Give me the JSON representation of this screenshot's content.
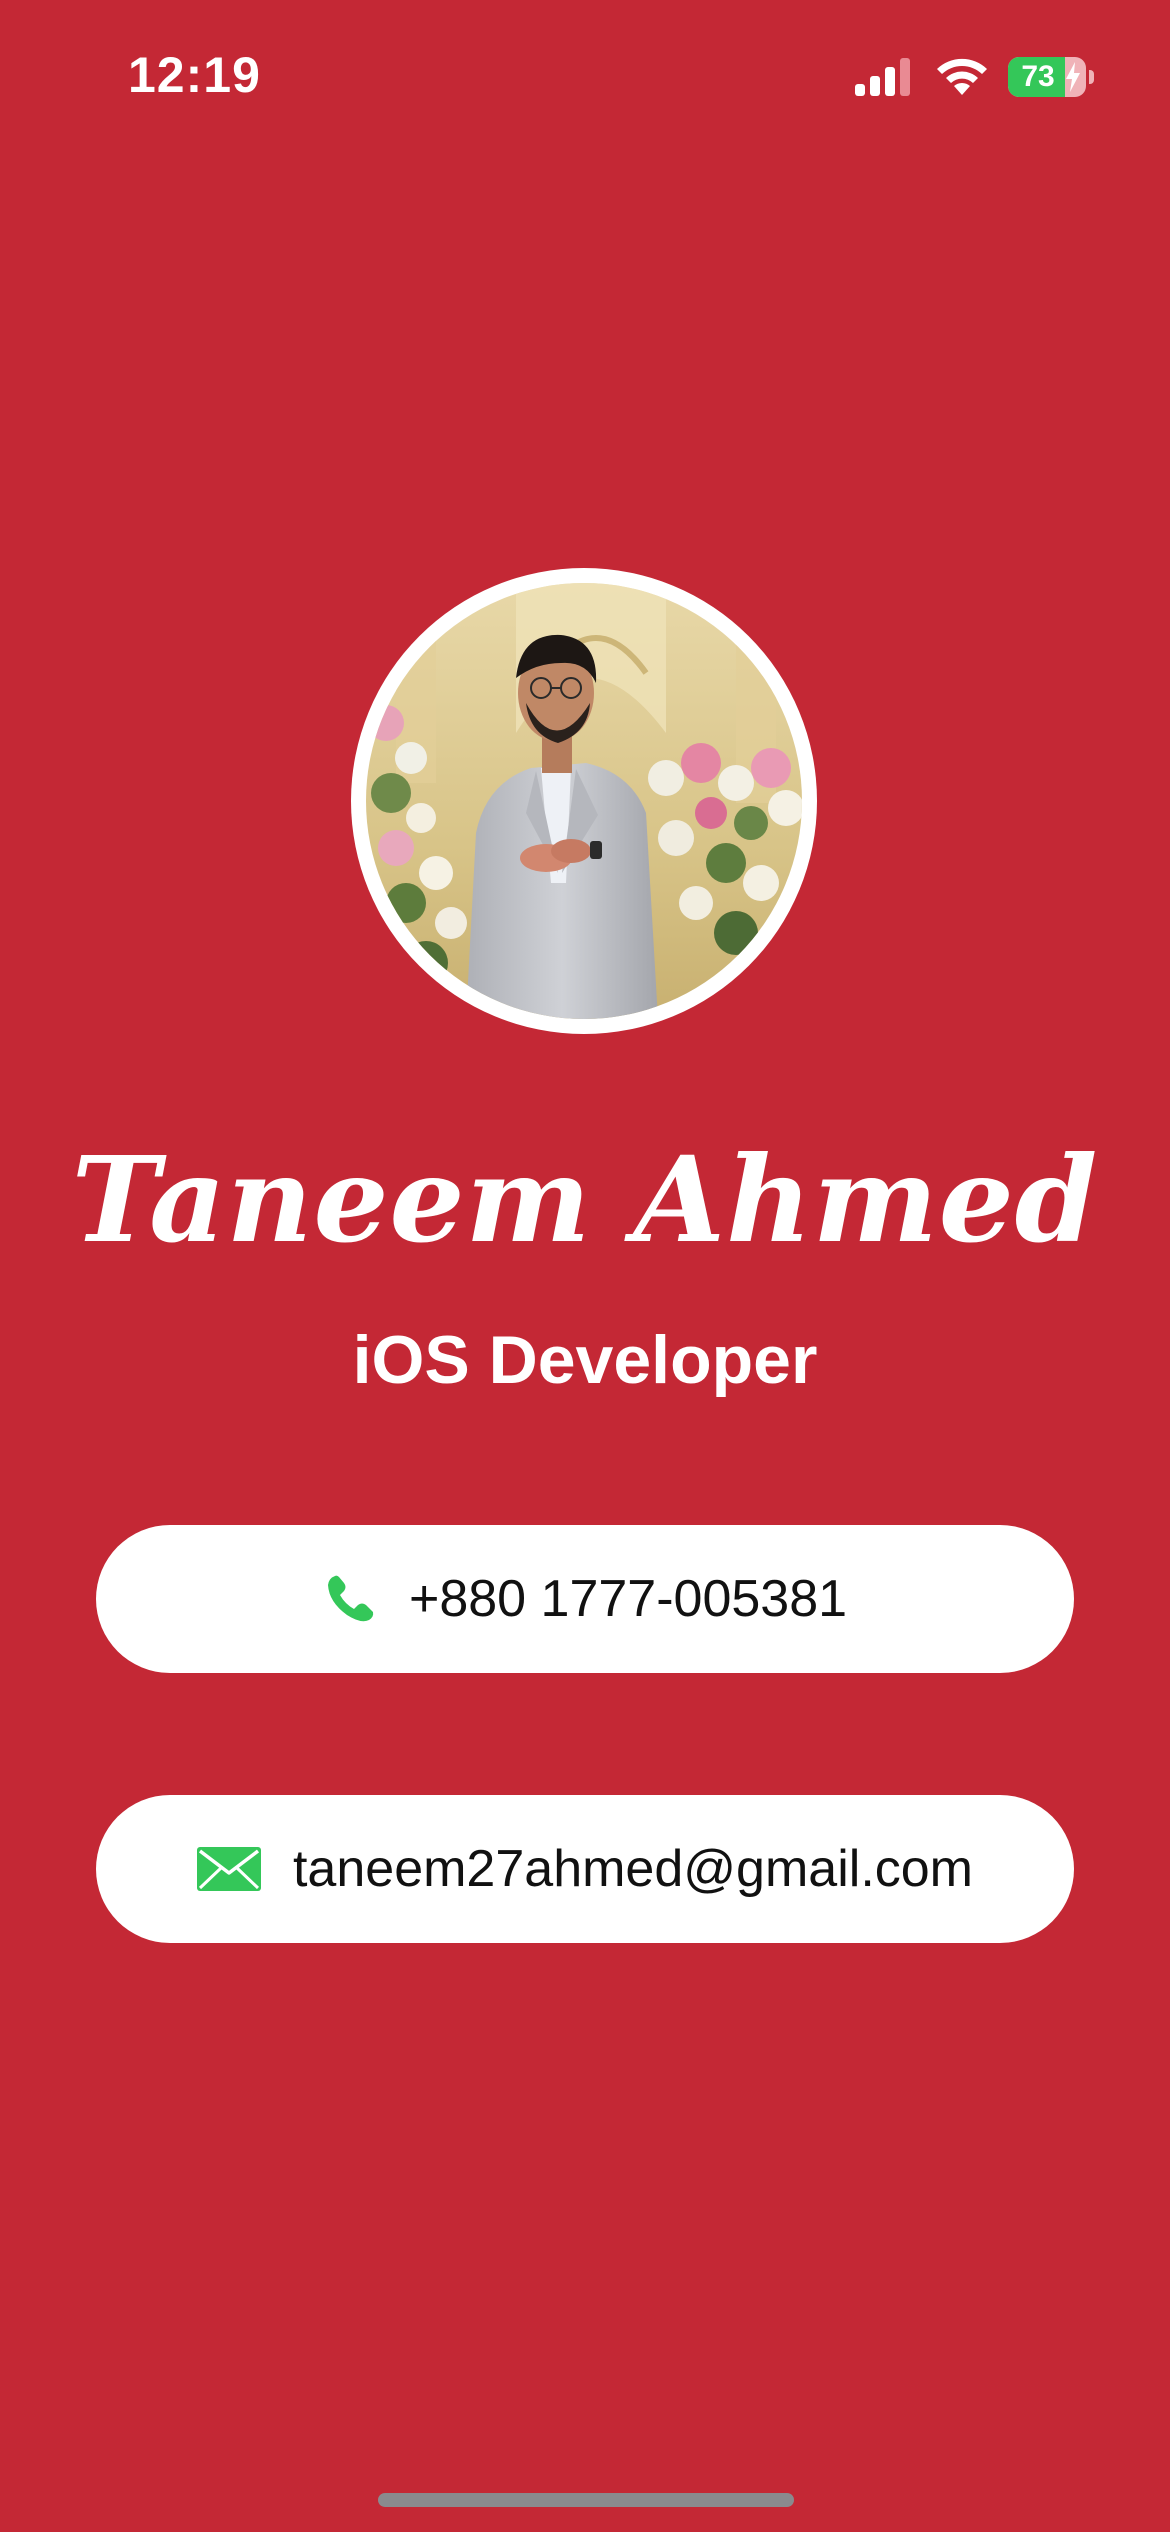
{
  "status_bar": {
    "time": "12:19",
    "battery_percent": "73",
    "battery_level": 0.73,
    "charging": true,
    "icons": [
      "cellular-signal-icon",
      "wifi-icon",
      "battery-charging-icon"
    ]
  },
  "profile": {
    "name": "Taneem Ahmed",
    "role": "iOS Developer"
  },
  "contacts": {
    "phone": {
      "icon": "phone-icon",
      "text": "+880 1777-005381"
    },
    "email": {
      "icon": "envelope-icon",
      "text": "taneem27ahmed@gmail.com"
    }
  },
  "colors": {
    "background": "#c42835",
    "card": "#ffffff",
    "accent_green": "#34c759",
    "text_dark": "#111111"
  }
}
